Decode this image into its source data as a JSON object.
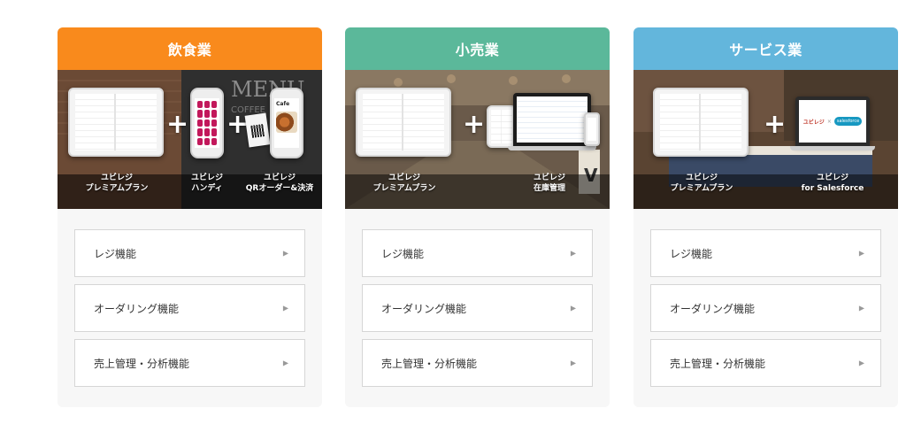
{
  "colors": {
    "restaurant": "#f98a1c",
    "retail": "#5bb89a",
    "service": "#63b6dc"
  },
  "cards": [
    {
      "title": "飲食業",
      "captions": [
        "ユビレジ\nプレミアムプラン",
        "ユビレジ\nハンディ",
        "ユビレジ\nQRオーダー&決済"
      ],
      "cafe_label": "Cafe",
      "menu": [
        "レジ機能",
        "オーダリング機能",
        "売上管理・分析機能"
      ]
    },
    {
      "title": "小売業",
      "captions": [
        "ユビレジ\nプレミアムプラン",
        "ユビレジ\n在庫管理"
      ],
      "menu": [
        "レジ機能",
        "オーダリング機能",
        "売上管理・分析機能"
      ]
    },
    {
      "title": "サービス業",
      "captions": [
        "ユビレジ\nプレミアムプラン",
        "ユビレジ\nfor Salesforce"
      ],
      "logo_left": "ユビレジ",
      "logo_sep": "×",
      "logo_right": "salesforce",
      "menu": [
        "レジ機能",
        "オーダリング機能",
        "売上管理・分析機能"
      ]
    }
  ],
  "icons": {
    "plus": "+",
    "arrow": "▶"
  }
}
